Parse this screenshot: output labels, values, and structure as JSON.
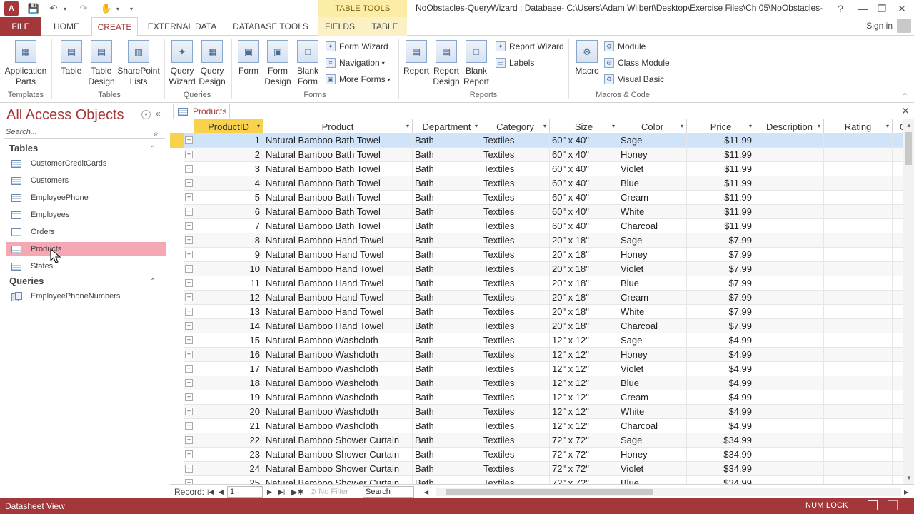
{
  "titlebar": {
    "logo": "A",
    "context_tools": "TABLE TOOLS",
    "window_title": "NoObstacles-QueryWizard : Database- C:\\Users\\Adam Wilbert\\Desktop\\Exercise Files\\Ch 05\\NoObstacles-...",
    "help": "?",
    "minimize": "—",
    "restore": "❐",
    "close": "✕"
  },
  "tabs": {
    "file": "FILE",
    "home": "HOME",
    "create": "CREATE",
    "external": "EXTERNAL DATA",
    "dbtools": "DATABASE TOOLS",
    "fields": "FIELDS",
    "table": "TABLE",
    "signin": "Sign in"
  },
  "ribbon": {
    "app_parts": "Application\nParts",
    "table": "Table",
    "table_design": "Table\nDesign",
    "sharepoint_lists": "SharePoint\nLists",
    "query_wizard": "Query\nWizard",
    "query_design": "Query\nDesign",
    "form": "Form",
    "form_design": "Form\nDesign",
    "blank_form": "Blank\nForm",
    "form_wizard": "Form Wizard",
    "navigation": "Navigation",
    "more_forms": "More Forms",
    "report": "Report",
    "report_design": "Report\nDesign",
    "blank_report": "Blank\nReport",
    "report_wizard": "Report Wizard",
    "labels": "Labels",
    "macro": "Macro",
    "module": "Module",
    "class_module": "Class Module",
    "visual_basic": "Visual Basic",
    "groups": {
      "templates": "Templates",
      "tables": "Tables",
      "queries": "Queries",
      "forms": "Forms",
      "reports": "Reports",
      "macros": "Macros & Code"
    }
  },
  "nav": {
    "title": "All Access Objects",
    "search_placeholder": "Search...",
    "group_tables": "Tables",
    "group_queries": "Queries",
    "tables": [
      "CustomerCreditCards",
      "Customers",
      "EmployeePhone",
      "Employees",
      "Orders",
      "Products",
      "States"
    ],
    "queries": [
      "EmployeePhoneNumbers"
    ]
  },
  "doc_tab": {
    "label": "Products"
  },
  "grid": {
    "columns": [
      "ProductID",
      "Product",
      "Department",
      "Category",
      "Size",
      "Color",
      "Price",
      "Description",
      "Rating",
      "C"
    ],
    "rows": [
      [
        1,
        "Natural Bamboo Bath Towel",
        "Bath",
        "Textiles",
        "60\" x 40\"",
        "Sage",
        "$11.99"
      ],
      [
        2,
        "Natural Bamboo Bath Towel",
        "Bath",
        "Textiles",
        "60\" x 40\"",
        "Honey",
        "$11.99"
      ],
      [
        3,
        "Natural Bamboo Bath Towel",
        "Bath",
        "Textiles",
        "60\" x 40\"",
        "Violet",
        "$11.99"
      ],
      [
        4,
        "Natural Bamboo Bath Towel",
        "Bath",
        "Textiles",
        "60\" x 40\"",
        "Blue",
        "$11.99"
      ],
      [
        5,
        "Natural Bamboo Bath Towel",
        "Bath",
        "Textiles",
        "60\" x 40\"",
        "Cream",
        "$11.99"
      ],
      [
        6,
        "Natural Bamboo Bath Towel",
        "Bath",
        "Textiles",
        "60\" x 40\"",
        "White",
        "$11.99"
      ],
      [
        7,
        "Natural Bamboo Bath Towel",
        "Bath",
        "Textiles",
        "60\" x 40\"",
        "Charcoal",
        "$11.99"
      ],
      [
        8,
        "Natural Bamboo Hand Towel",
        "Bath",
        "Textiles",
        "20\" x 18\"",
        "Sage",
        "$7.99"
      ],
      [
        9,
        "Natural Bamboo Hand Towel",
        "Bath",
        "Textiles",
        "20\" x 18\"",
        "Honey",
        "$7.99"
      ],
      [
        10,
        "Natural Bamboo Hand Towel",
        "Bath",
        "Textiles",
        "20\" x 18\"",
        "Violet",
        "$7.99"
      ],
      [
        11,
        "Natural Bamboo Hand Towel",
        "Bath",
        "Textiles",
        "20\" x 18\"",
        "Blue",
        "$7.99"
      ],
      [
        12,
        "Natural Bamboo Hand Towel",
        "Bath",
        "Textiles",
        "20\" x 18\"",
        "Cream",
        "$7.99"
      ],
      [
        13,
        "Natural Bamboo Hand Towel",
        "Bath",
        "Textiles",
        "20\" x 18\"",
        "White",
        "$7.99"
      ],
      [
        14,
        "Natural Bamboo Hand Towel",
        "Bath",
        "Textiles",
        "20\" x 18\"",
        "Charcoal",
        "$7.99"
      ],
      [
        15,
        "Natural Bamboo Washcloth",
        "Bath",
        "Textiles",
        "12\" x 12\"",
        "Sage",
        "$4.99"
      ],
      [
        16,
        "Natural Bamboo Washcloth",
        "Bath",
        "Textiles",
        "12\" x 12\"",
        "Honey",
        "$4.99"
      ],
      [
        17,
        "Natural Bamboo Washcloth",
        "Bath",
        "Textiles",
        "12\" x 12\"",
        "Violet",
        "$4.99"
      ],
      [
        18,
        "Natural Bamboo Washcloth",
        "Bath",
        "Textiles",
        "12\" x 12\"",
        "Blue",
        "$4.99"
      ],
      [
        19,
        "Natural Bamboo Washcloth",
        "Bath",
        "Textiles",
        "12\" x 12\"",
        "Cream",
        "$4.99"
      ],
      [
        20,
        "Natural Bamboo Washcloth",
        "Bath",
        "Textiles",
        "12\" x 12\"",
        "White",
        "$4.99"
      ],
      [
        21,
        "Natural Bamboo Washcloth",
        "Bath",
        "Textiles",
        "12\" x 12\"",
        "Charcoal",
        "$4.99"
      ],
      [
        22,
        "Natural Bamboo Shower Curtain",
        "Bath",
        "Textiles",
        "72\" x 72\"",
        "Sage",
        "$34.99"
      ],
      [
        23,
        "Natural Bamboo Shower Curtain",
        "Bath",
        "Textiles",
        "72\" x 72\"",
        "Honey",
        "$34.99"
      ],
      [
        24,
        "Natural Bamboo Shower Curtain",
        "Bath",
        "Textiles",
        "72\" x 72\"",
        "Violet",
        "$34.99"
      ],
      [
        25,
        "Natural Bamboo Shower Curtain",
        "Bath",
        "Textiles",
        "72\" x 72\"",
        "Blue",
        "$34.99"
      ]
    ]
  },
  "recnav": {
    "label": "Record:",
    "current": "1",
    "no_filter": "No Filter",
    "search": "Search"
  },
  "status": {
    "view": "Datasheet View",
    "numlock": "NUM LOCK"
  },
  "colors": {
    "accent": "#a4373a",
    "selected_nav": "#f3a8b4",
    "current_row": "#cfe3f9",
    "header_selected": "#f8d24d"
  }
}
